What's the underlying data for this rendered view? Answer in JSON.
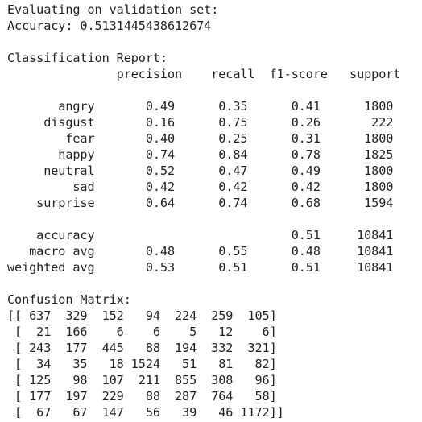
{
  "output": {
    "eval_header": "Evaluating on validation set:",
    "accuracy_line": "Accuracy: 0.5131445438612674",
    "blank_1": "",
    "report_title": "Classification Report:",
    "report_header": "               precision    recall  f1-score   support",
    "blank_2": "",
    "rows": [
      "       angry       0.49      0.35      0.41      1800",
      "     disgust       0.16      0.75      0.26       222",
      "        fear       0.40      0.25      0.31      1800",
      "       happy       0.74      0.84      0.78      1825",
      "     neutral       0.52      0.47      0.49      1800",
      "         sad       0.42      0.42      0.42      1800",
      "    surprise       0.64      0.74      0.68      1594"
    ],
    "blank_3": "",
    "summary_rows": [
      "    accuracy                           0.51     10841",
      "   macro avg       0.48      0.55      0.48     10841",
      "weighted avg       0.53      0.51      0.51     10841"
    ],
    "blank_4": "",
    "matrix_title": "Confusion Matrix:",
    "matrix_rows": [
      "[[ 637  329  152   94  224  259  105]",
      " [  21  166    6    6    5   12    6]",
      " [ 243  177  445   88  194  332  321]",
      " [  34   35   18 1524   51   81   82]",
      " [ 125   98  107  211  855  308   96]",
      " [ 177  197  229   88  287  764   58]",
      " [  67   67  147   56   39   46 1172]]"
    ]
  }
}
